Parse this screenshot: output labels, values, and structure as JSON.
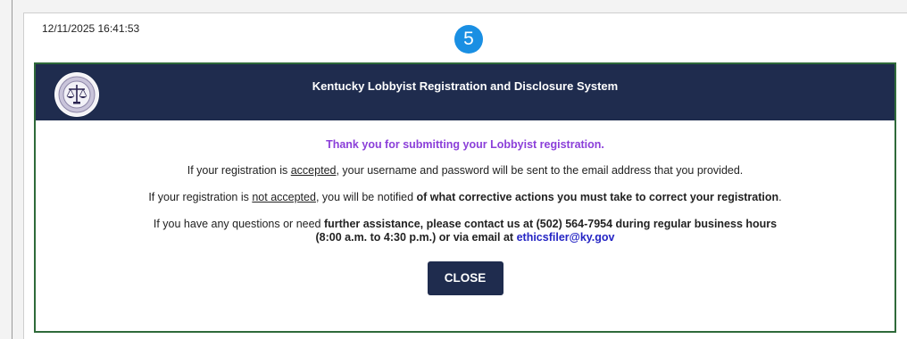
{
  "timestamp": "12/11/2025 16:41:53",
  "step_number": "5",
  "modal": {
    "title": "Kentucky Lobbyist Registration and Disclosure System",
    "thanks": "Thank you for submitting your Lobbyist registration.",
    "p1": {
      "a": "If your registration is ",
      "accepted": "accepted",
      "b": ", your username and password will be sent to the email address that you provided."
    },
    "p2": {
      "a": "If your registration is ",
      "not_accepted": "not accepted",
      "b": ", you will be notified ",
      "bold": "of what corrective actions you must take to correct your registration",
      "c": "."
    },
    "p3": {
      "a": "If you have any questions or need ",
      "bold1": "further assistance, please contact us at (502) 564-7954 during regular business hours",
      "bold2": "(8:00 a.m. to 4:30 p.m.) or via email at ",
      "email": "ethicsfiler@ky.gov"
    },
    "close_label": "CLOSE"
  },
  "colors": {
    "header_bg": "#1f2c4e",
    "modal_border": "#2f6a3a",
    "thanks_text": "#8b3fd9",
    "badge": "#1a8fe3",
    "link": "#2424c4"
  },
  "icons": {
    "seal": "kentucky-state-seal-icon"
  }
}
